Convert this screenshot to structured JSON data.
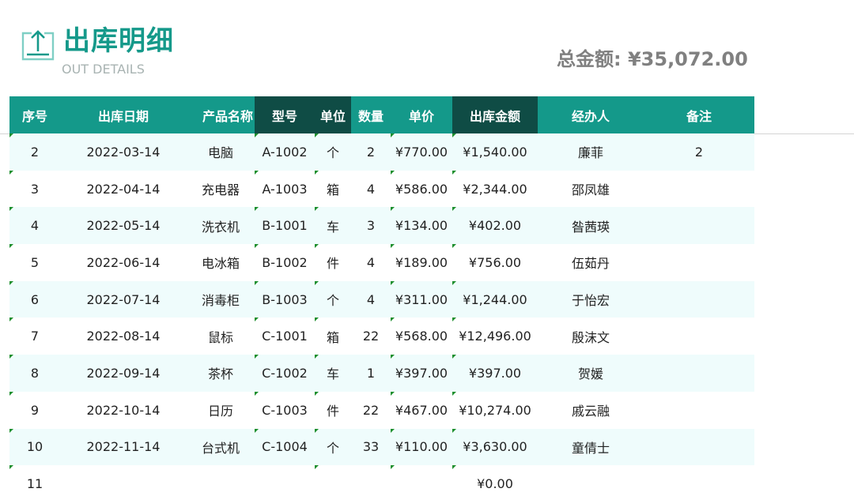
{
  "header": {
    "title": "出库明细",
    "subtitle": "OUT DETAILS",
    "total_label": "总金额:",
    "total_value": "¥35,072.00",
    "accent_color": "#15998a",
    "logo_icon": "export-upload-icon"
  },
  "table": {
    "columns": [
      "序号",
      "出库日期",
      "产品名称",
      "型号",
      "单位",
      "数量",
      "单价",
      "出库金额",
      "经办人",
      "备注"
    ],
    "rows": [
      {
        "no": "2",
        "date": "2022-03-14",
        "product": "电脑",
        "model": "A-1002",
        "unit": "个",
        "qty": "2",
        "price": "¥770.00",
        "amount": "¥1,540.00",
        "handler": "廉菲",
        "note": "2"
      },
      {
        "no": "3",
        "date": "2022-04-14",
        "product": "充电器",
        "model": "A-1003",
        "unit": "箱",
        "qty": "4",
        "price": "¥586.00",
        "amount": "¥2,344.00",
        "handler": "邵凤雄",
        "note": ""
      },
      {
        "no": "4",
        "date": "2022-05-14",
        "product": "洗衣机",
        "model": "B-1001",
        "unit": "车",
        "qty": "3",
        "price": "¥134.00",
        "amount": "¥402.00",
        "handler": "昝茜瑛",
        "note": ""
      },
      {
        "no": "5",
        "date": "2022-06-14",
        "product": "电冰箱",
        "model": "B-1002",
        "unit": "件",
        "qty": "4",
        "price": "¥189.00",
        "amount": "¥756.00",
        "handler": "伍茹丹",
        "note": ""
      },
      {
        "no": "6",
        "date": "2022-07-14",
        "product": "消毒柜",
        "model": "B-1003",
        "unit": "个",
        "qty": "4",
        "price": "¥311.00",
        "amount": "¥1,244.00",
        "handler": "于怡宏",
        "note": ""
      },
      {
        "no": "7",
        "date": "2022-08-14",
        "product": "鼠标",
        "model": "C-1001",
        "unit": "箱",
        "qty": "22",
        "price": "¥568.00",
        "amount": "¥12,496.00",
        "handler": "殷沫文",
        "note": ""
      },
      {
        "no": "8",
        "date": "2022-09-14",
        "product": "茶杯",
        "model": "C-1002",
        "unit": "车",
        "qty": "1",
        "price": "¥397.00",
        "amount": "¥397.00",
        "handler": "贺媛",
        "note": ""
      },
      {
        "no": "9",
        "date": "2022-10-14",
        "product": "日历",
        "model": "C-1003",
        "unit": "件",
        "qty": "22",
        "price": "¥467.00",
        "amount": "¥10,274.00",
        "handler": "戚云融",
        "note": ""
      },
      {
        "no": "10",
        "date": "2022-11-14",
        "product": "台式机",
        "model": "C-1004",
        "unit": "个",
        "qty": "33",
        "price": "¥110.00",
        "amount": "¥3,630.00",
        "handler": "童倩士",
        "note": ""
      },
      {
        "no": "11",
        "date": "",
        "product": "",
        "model": "",
        "unit": "",
        "qty": "",
        "price": "",
        "amount": "¥0.00",
        "handler": "",
        "note": ""
      }
    ]
  }
}
